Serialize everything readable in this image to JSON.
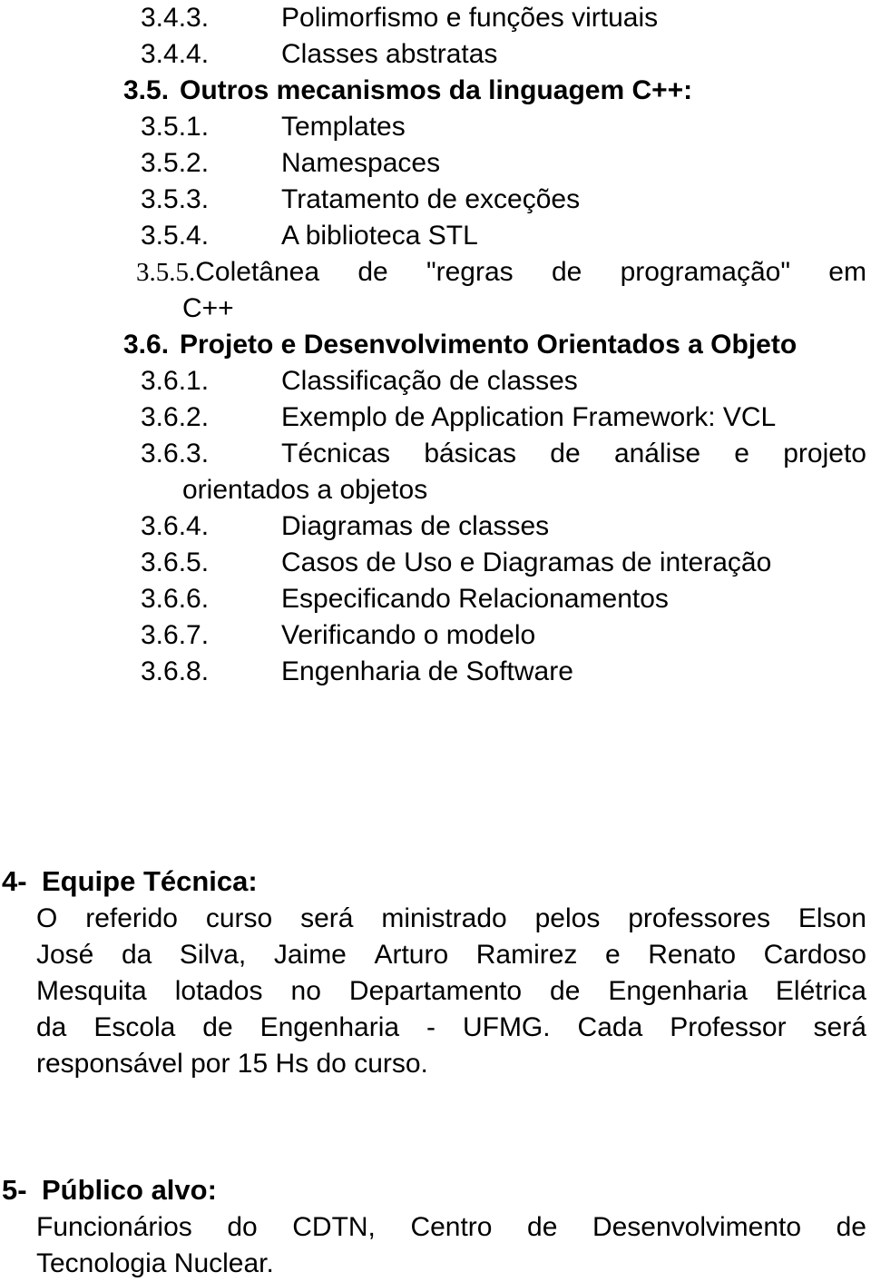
{
  "document": {
    "language": "pt-BR",
    "outline": [
      {
        "kind": "item",
        "number": "3.4.3.",
        "text": "Polimorfismo e funções virtuais"
      },
      {
        "kind": "item",
        "number": "3.4.4.",
        "text": "Classes abstratas"
      },
      {
        "kind": "heading",
        "number": "3.5.",
        "text": "Outros mecanismos da linguagem C++:"
      },
      {
        "kind": "item",
        "number": "3.5.1.",
        "text": "Templates"
      },
      {
        "kind": "item",
        "number": "3.5.2.",
        "text": "Namespaces"
      },
      {
        "kind": "item",
        "number": "3.5.3.",
        "text": "Tratamento de exceções"
      },
      {
        "kind": "item",
        "number": "3.5.4.",
        "text": "A biblioteca STL"
      },
      {
        "kind": "item-serif",
        "number": "3.5.5.",
        "text": "Coletânea de \"regras de programação\" em C++",
        "line1_words": [
          "Coletânea",
          "de",
          "\"regras",
          "de",
          "programação\"",
          "em"
        ],
        "line2": "C++"
      },
      {
        "kind": "heading",
        "number": "3.6.",
        "text": "Projeto e Desenvolvimento Orientados a Objeto"
      },
      {
        "kind": "item",
        "number": "3.6.1.",
        "text": "Classificação de classes"
      },
      {
        "kind": "item",
        "number": "3.6.2.",
        "text": "Exemplo de Application Framework: VCL"
      },
      {
        "kind": "item-wrap",
        "number": "3.6.3.",
        "text": "Técnicas básicas de análise e projeto orientados a objetos",
        "line1_words": [
          "Técnicas",
          "básicas",
          "de",
          "análise",
          "e",
          "projeto"
        ],
        "line2": "orientados a objetos"
      },
      {
        "kind": "item",
        "number": "3.6.4.",
        "text": "Diagramas de classes"
      },
      {
        "kind": "item",
        "number": "3.6.5.",
        "text": "Casos de Uso e Diagramas de interação"
      },
      {
        "kind": "item",
        "number": "3.6.6.",
        "text": "Especificando Relacionamentos"
      },
      {
        "kind": "item",
        "number": "3.6.7.",
        "text": "Verificando o modelo"
      },
      {
        "kind": "item",
        "number": "3.6.8.",
        "text": "Engenharia de Software"
      }
    ],
    "sections": [
      {
        "marker": "4-",
        "title": "Equipe Técnica:",
        "body_text": "O referido curso será ministrado pelos professores Elson José da Silva, Jaime Arturo Ramirez e Renato Cardoso Mesquita lotados no Departamento de Engenharia Elétrica da Escola de Engenharia - UFMG. Cada Professor será responsável por 15 Hs do curso.",
        "body_lines": [
          {
            "words": [
              "O",
              "referido",
              "curso",
              "será",
              "ministrado",
              "pelos",
              "professores",
              "Elson"
            ],
            "justified": true
          },
          {
            "words": [
              "José",
              "da",
              "Silva,",
              "Jaime",
              "Arturo",
              "Ramirez",
              "e",
              "Renato",
              "Cardoso"
            ],
            "justified": true
          },
          {
            "words": [
              "Mesquita",
              "lotados",
              "no",
              "Departamento",
              "de",
              "Engenharia",
              "Elétrica"
            ],
            "justified": true
          },
          {
            "words": [
              "da",
              "Escola",
              "de",
              "Engenharia",
              "-",
              "UFMG.",
              "Cada",
              "Professor",
              "será"
            ],
            "justified": true
          },
          {
            "words": [
              "responsável por 15 Hs do curso."
            ],
            "justified": false
          }
        ]
      },
      {
        "marker": "5-",
        "title": "Público alvo:",
        "body_text": "Funcionários do CDTN, Centro de Desenvolvimento de Tecnologia Nuclear.",
        "body_lines": [
          {
            "words": [
              "Funcionários",
              "do",
              "CDTN,",
              "Centro",
              "de",
              "Desenvolvimento",
              "de"
            ],
            "justified": true
          },
          {
            "words": [
              "Tecnologia Nuclear."
            ],
            "justified": false
          }
        ]
      }
    ]
  }
}
